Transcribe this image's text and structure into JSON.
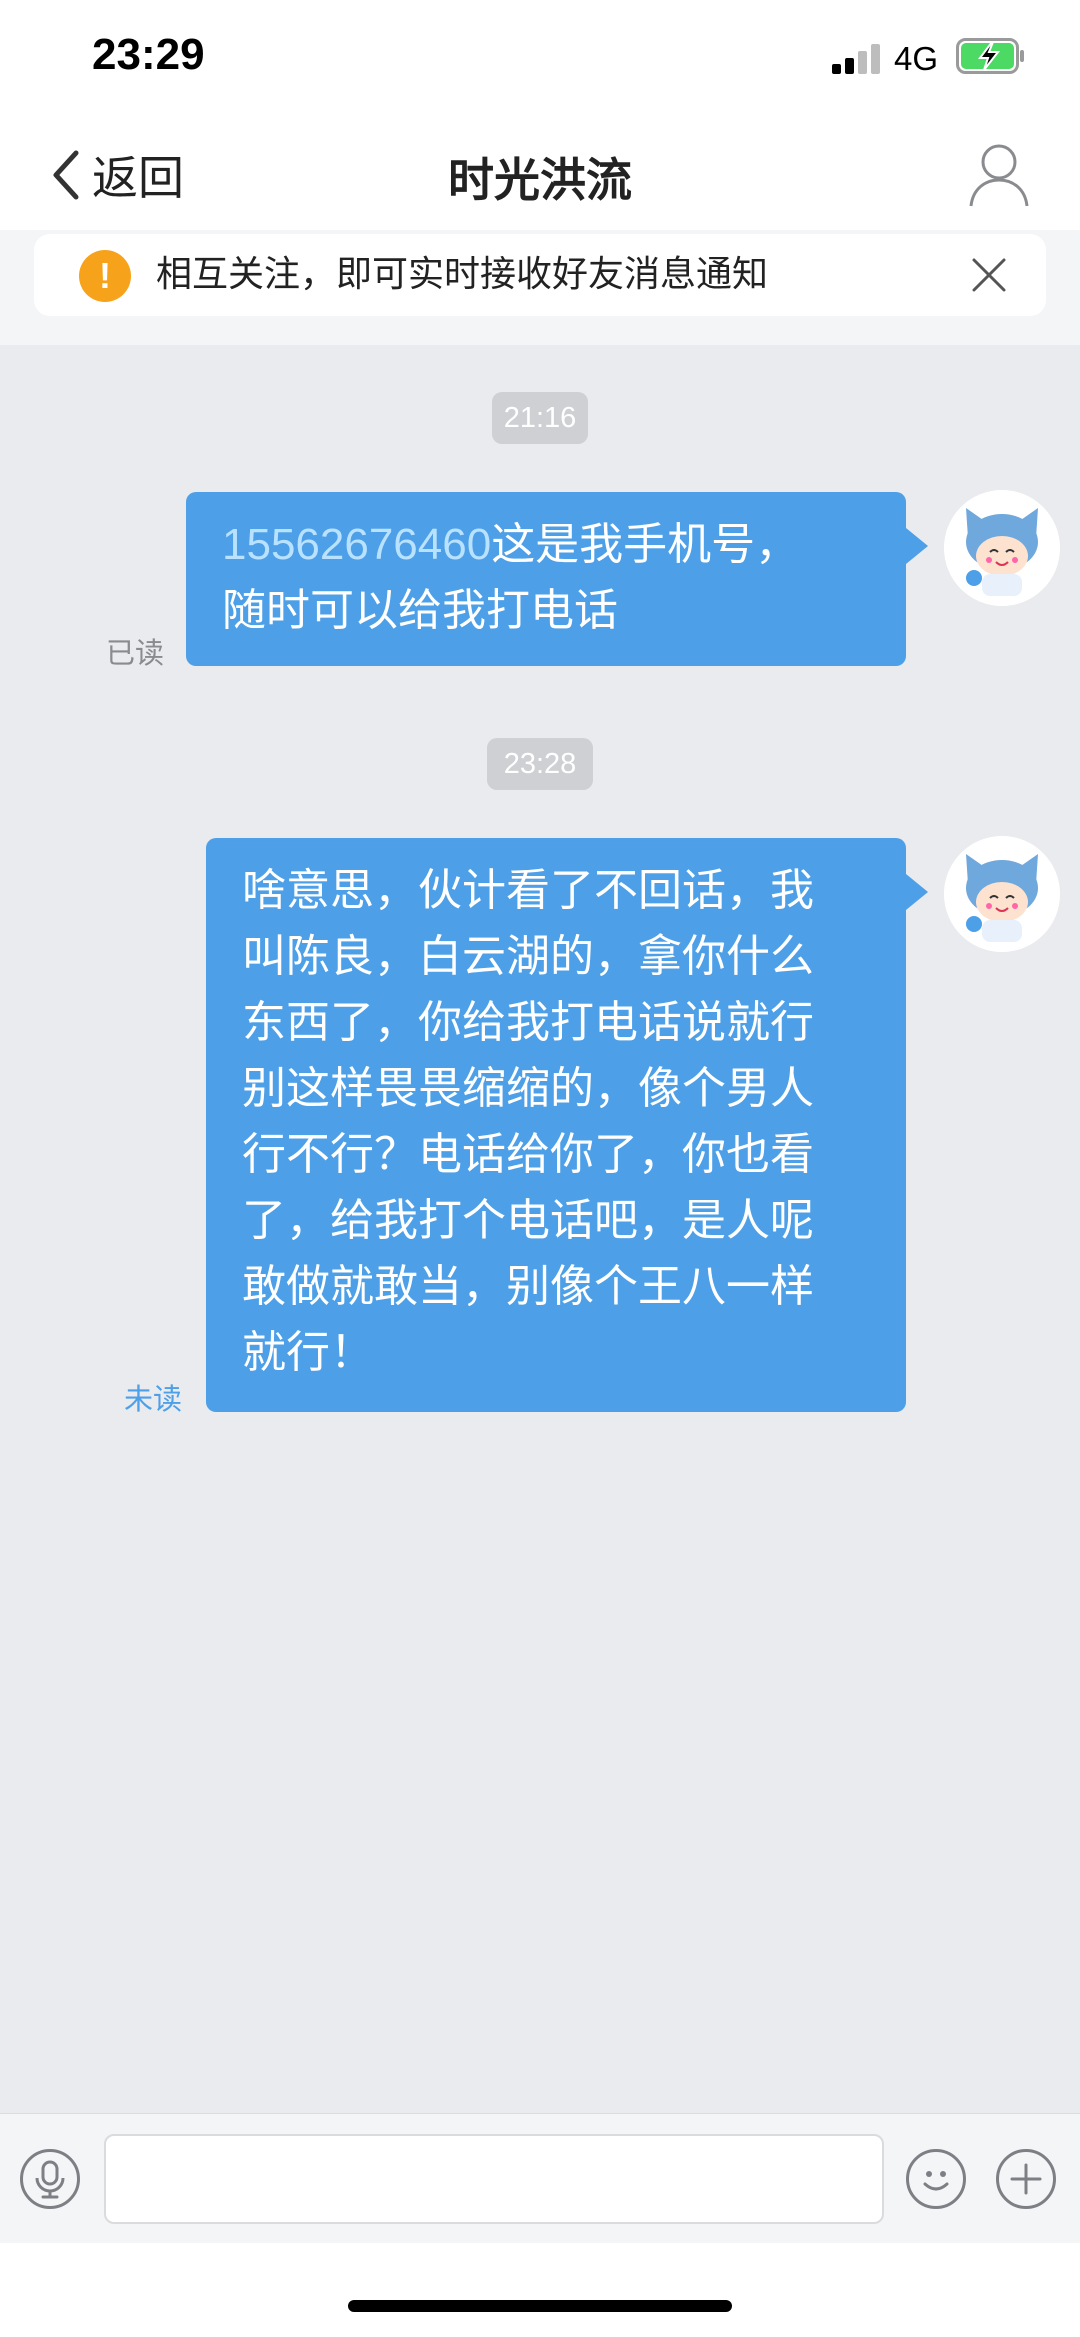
{
  "status_bar": {
    "time": "23:29",
    "network": "4G"
  },
  "nav": {
    "back_label": "返回",
    "title": "时光洪流"
  },
  "notice": {
    "text": "相互关注，即可实时接收好友消息通知",
    "icon": "warning-icon",
    "icon_glyph": "!"
  },
  "messages": [
    {
      "timestamp": "21:16",
      "phone": "15562676460",
      "lines": [
        "这是我手机号，",
        "随时可以给我打电话"
      ],
      "status": "已读"
    },
    {
      "timestamp": "23:28",
      "lines": [
        "啥意思，伙计看了不回话，我",
        "叫陈良，白云湖的，拿你什么",
        "东西了，你给我打电话说就行",
        "别这样畏畏缩缩的，像个男人",
        "行不行？电话给你了，你也看",
        "了，给我打个电话吧，是人呢",
        "敢做就敢当，别像个王八一样",
        "就行！"
      ],
      "status": "未读"
    }
  ],
  "colors": {
    "bubble": "#4d9fe8",
    "read_status": "#8a8b8f",
    "unread_status": "#4d9fe8",
    "warning": "#f7a21b",
    "battery_fill": "#4cd964"
  },
  "icons": {
    "back": "chevron-left-icon",
    "profile": "person-icon",
    "close": "close-icon",
    "voice": "microphone-icon",
    "emoji": "smiley-icon",
    "more": "plus-icon"
  }
}
